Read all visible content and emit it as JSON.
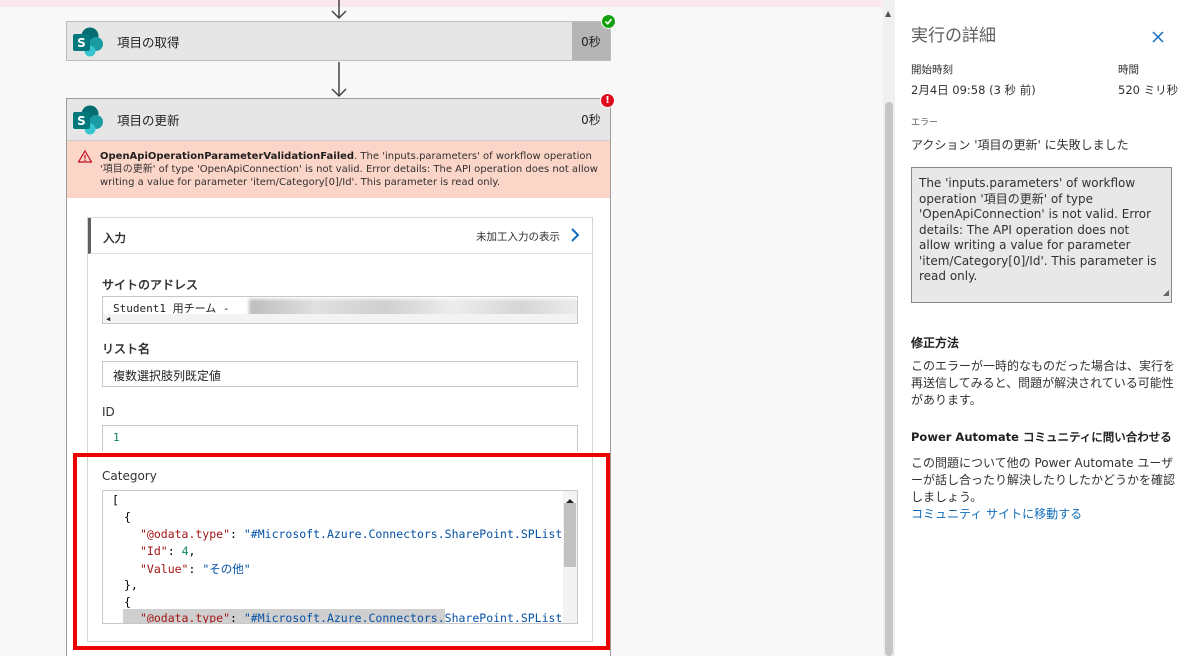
{
  "flow": {
    "action1": {
      "title": "項目の取得",
      "duration": "0秒",
      "status": "succeeded"
    },
    "action2": {
      "title": "項目の更新",
      "duration": "0秒",
      "status": "failed",
      "error_code": "OpenApiOperationParameterValidationFailed",
      "error_text": ". The 'inputs.parameters' of workflow operation '項目の更新' of type 'OpenApiConnection' is not valid. Error details: The API operation does not allow writing a value for parameter 'item/Category[0]/Id'. This parameter is read only.",
      "inputs": {
        "label": "入力",
        "raw_link": "未加工入力の表示",
        "site_label": "サイトのアドレス",
        "site_value": "Student1 用チーム -",
        "list_label": "リスト名",
        "list_value": "複数選択肢列既定値",
        "id_label": "ID",
        "id_value": "1",
        "category_label": "Category",
        "category_code": {
          "line1": "[",
          "line2": "{",
          "line3_key": "\"@odata.type\"",
          "line3_val": "\"#Microsoft.Azure.Connectors.SharePoint.SPListEx",
          "line4_key": "\"Id\"",
          "line4_val": "4",
          "line5_key": "\"Value\"",
          "line5_val": "\"その他\"",
          "line6": "},",
          "line7": "{",
          "line8_key": "\"@odata.type\"",
          "line8_val": "\"#Microsoft.Azure.Connectors.SharePoint.SPListEx"
        }
      }
    }
  },
  "panel": {
    "title": "実行の詳細",
    "start_label": "開始時刻",
    "start_value": "2月4日 09:58 (3 秒 前)",
    "duration_label": "時間",
    "duration_value": "520 ミリ秒",
    "error_label": "エラー",
    "error_message": "アクション '項目の更新' に失敗しました",
    "error_detail": "The 'inputs.parameters' of workflow operation '項目の更新' of type 'OpenApiConnection' is not valid. Error details: The API operation does not allow writing a value for parameter 'item/Category[0]/Id'. This parameter is read only.",
    "fix_title": "修正方法",
    "fix_text": "このエラーが一時的なものだった場合は、実行を再送信してみると、問題が解決されている可能性があります。",
    "community_title": "Power Automate コミュニティに問い合わせる",
    "community_text": "この問題について他の Power Automate ユーザーが話し合ったり解決したりしたかどうかを確認しましょう。",
    "community_link": "コミュニティ サイトに移動する"
  },
  "colors": {
    "error_red": "#e00b1c",
    "success_green": "#13a10e",
    "highlight_frame": "#ec0000",
    "error_banner_bg": "#fbd5c8",
    "link_blue": "#0f6cbd"
  },
  "icons": {
    "action_icon": "sharepoint-icon",
    "success": "check-icon",
    "failure": "exclamation-icon",
    "warning": "warning-icon",
    "expand": "chevron-right-icon",
    "close": "close-icon"
  }
}
